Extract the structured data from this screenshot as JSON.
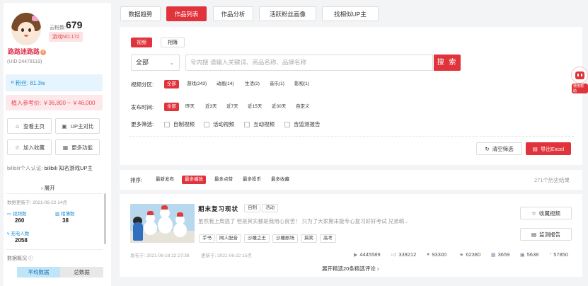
{
  "profile": {
    "fans_count_label": "云粉数:",
    "fans_count": "679",
    "rank_badge": "游戏NO.172",
    "username": "路路迷路路",
    "uid": "(UID:24478119)",
    "fans": "粉丝: 81.3w",
    "price": "植入参考价: ￥36,800 ~ ￥46,000"
  },
  "actions": {
    "home": "查看主页",
    "compare": "UP主对比",
    "favorite": "加入收藏",
    "more": "更多功能"
  },
  "certification": {
    "prefix": "bilibili个人认证:",
    "text": "bilibili 知名游戏UP主",
    "expand": "展开"
  },
  "stats": {
    "updated": "数据更新于: 2021-06-22 14点",
    "video_count_label": "视频数",
    "video_count": "260",
    "album_count_label": "相簿数",
    "album_count": "38",
    "charge_label": "充电人数",
    "charge_count": "2058"
  },
  "data_overview": {
    "label": "数据概况",
    "avg": "平均数据",
    "total": "总数据"
  },
  "top_tabs": [
    "数据趋势",
    "作品列表",
    "作品分析",
    "活跃粉丝画像",
    "找相似UP主"
  ],
  "filter": {
    "type_tabs": [
      "视频",
      "相簿"
    ],
    "select_value": "全部",
    "search_placeholder": "号内搜 请输入关键词、商品名称、品牌名称",
    "search_button": "搜 索",
    "partition_label": "视频分区:",
    "partitions": [
      "全部",
      "游戏(243)",
      "动画(14)",
      "生活(2)",
      "音乐(1)",
      "影视(1)"
    ],
    "time_label": "发布时间:",
    "times": [
      "全部",
      "昨天",
      "近3天",
      "近7天",
      "近15天",
      "近30天",
      "自定义"
    ],
    "more_label": "更多筛选:",
    "more_options": [
      "自制视频",
      "活动视频",
      "互动视频",
      "含监测报告"
    ],
    "clear": "清空筛选",
    "export": "导出Excel"
  },
  "sort": {
    "label": "排序:",
    "options": [
      "最新发布",
      "最多播放",
      "最多点赞",
      "最多投币",
      "最多收藏"
    ],
    "history": "271个历史结果"
  },
  "video": {
    "title": "期末复习现状",
    "tags": [
      "自制",
      "活动"
    ],
    "desc": "虽然我上周逃了 但是其实都是我用心良苦！ 只为了大家期末能专心复习好好考试 兄弟萌...",
    "topic_tags": [
      "手书",
      "网人配音",
      "沙雕之王",
      "沙雕剧场",
      "搞笑",
      "高考"
    ],
    "publish": "发布于: 2021-06-18 22:27:38",
    "updated": "更新于: 2021-06-22 15点",
    "plays": "4445589",
    "likes": "339212",
    "coins": "93300",
    "favs": "62380",
    "danmaku": "3659",
    "shares": "5638",
    "comments": "57850",
    "collect_btn": "收藏视频",
    "report_btn": "监测报告",
    "more_comments": "展开精选20条精选评论"
  },
  "assistant_label": "使用帮助",
  "colors": {
    "accent": "#e1333b",
    "blue": "#1d8fd6"
  }
}
